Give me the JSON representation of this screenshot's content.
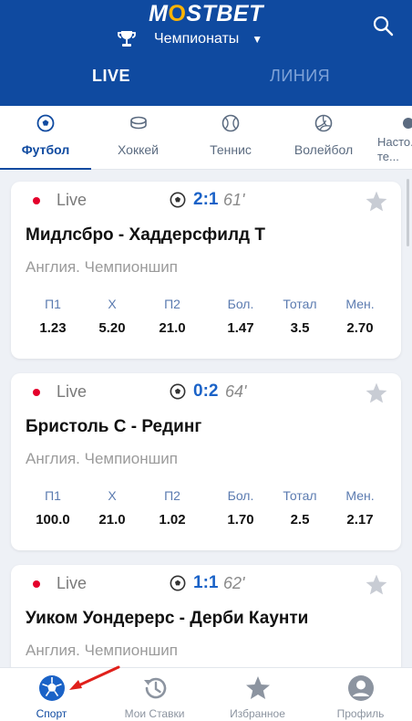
{
  "header": {
    "logo": "MOSTBET",
    "championships_label": "Чемпионаты",
    "tab_live": "LIVE",
    "tab_line": "ЛИНИЯ"
  },
  "sports": [
    {
      "label": "Футбол",
      "icon": "soccer-ball-icon"
    },
    {
      "label": "Хоккей",
      "icon": "hockey-puck-icon"
    },
    {
      "label": "Теннис",
      "icon": "tennis-ball-icon"
    },
    {
      "label": "Волейбол",
      "icon": "volleyball-icon"
    },
    {
      "label": "Насто... те...",
      "icon": "table-tennis-icon"
    }
  ],
  "matches": [
    {
      "status": "Live",
      "score": "2:1",
      "minute": "61'",
      "teams": "Мидлсбро - Хаддерсфилд Т",
      "league": "Англия. Чемпионшип",
      "odds": [
        {
          "type": "П1",
          "value": "1.23"
        },
        {
          "type": "Х",
          "value": "5.20"
        },
        {
          "type": "П2",
          "value": "21.0"
        },
        {
          "type": "Бол.",
          "value": "1.47"
        },
        {
          "type": "Тотал",
          "value": "3.5"
        },
        {
          "type": "Мен.",
          "value": "2.70"
        }
      ]
    },
    {
      "status": "Live",
      "score": "0:2",
      "minute": "64'",
      "teams": "Бристоль С - Рединг",
      "league": "Англия. Чемпионшип",
      "odds": [
        {
          "type": "П1",
          "value": "100.0"
        },
        {
          "type": "Х",
          "value": "21.0"
        },
        {
          "type": "П2",
          "value": "1.02"
        },
        {
          "type": "Бол.",
          "value": "1.70"
        },
        {
          "type": "Тотал",
          "value": "2.5"
        },
        {
          "type": "Мен.",
          "value": "2.17"
        }
      ]
    },
    {
      "status": "Live",
      "score": "1:1",
      "minute": "62'",
      "teams": "Уиком Уондерерс - Дерби Каунти",
      "league": "Англия. Чемпионшип"
    }
  ],
  "bottom_nav": [
    {
      "label": "Спорт",
      "icon": "soccer-ball-icon"
    },
    {
      "label": "Мои Ставки",
      "icon": "history-icon"
    },
    {
      "label": "Избранное",
      "icon": "star-icon"
    },
    {
      "label": "Профиль",
      "icon": "profile-icon"
    }
  ],
  "colors": {
    "brand_blue": "#0f4aa0",
    "live_red": "#e4002b",
    "score_blue": "#1a62c7",
    "logo_star": "#ffb300",
    "arrow_red": "#e0201b"
  }
}
